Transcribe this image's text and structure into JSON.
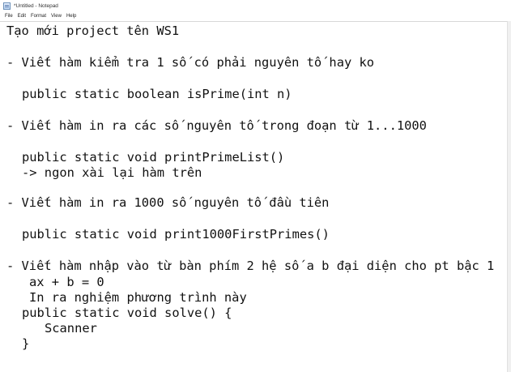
{
  "window": {
    "title": "*Untitled - Notepad"
  },
  "menu": {
    "items": [
      {
        "label": "File"
      },
      {
        "label": "Edit"
      },
      {
        "label": "Format"
      },
      {
        "label": "View"
      },
      {
        "label": "Help"
      }
    ]
  },
  "document": {
    "lines": [
      "Tạo mới project tên WS1",
      "- Viết hàm kiểm tra 1 số có phải nguyên tố hay ko",
      "public static boolean isPrime(int n)",
      "- Viết hàm in ra các số nguyên tố trong đoạn từ 1...1000",
      "public static void printPrimeList()",
      "-> ngon xài lại hàm trên",
      "- Viết hàm in ra 1000 số nguyên tố đầu tiên",
      "public static void print1000FirstPrimes()",
      "- Viết hàm nhập vào từ bàn phím 2 hệ số a b đại diện cho pt bậc 1",
      "ax + b = 0",
      "In ra nghiệm phương trình này",
      "public static void solve() {",
      "Scanner",
      "}"
    ]
  }
}
